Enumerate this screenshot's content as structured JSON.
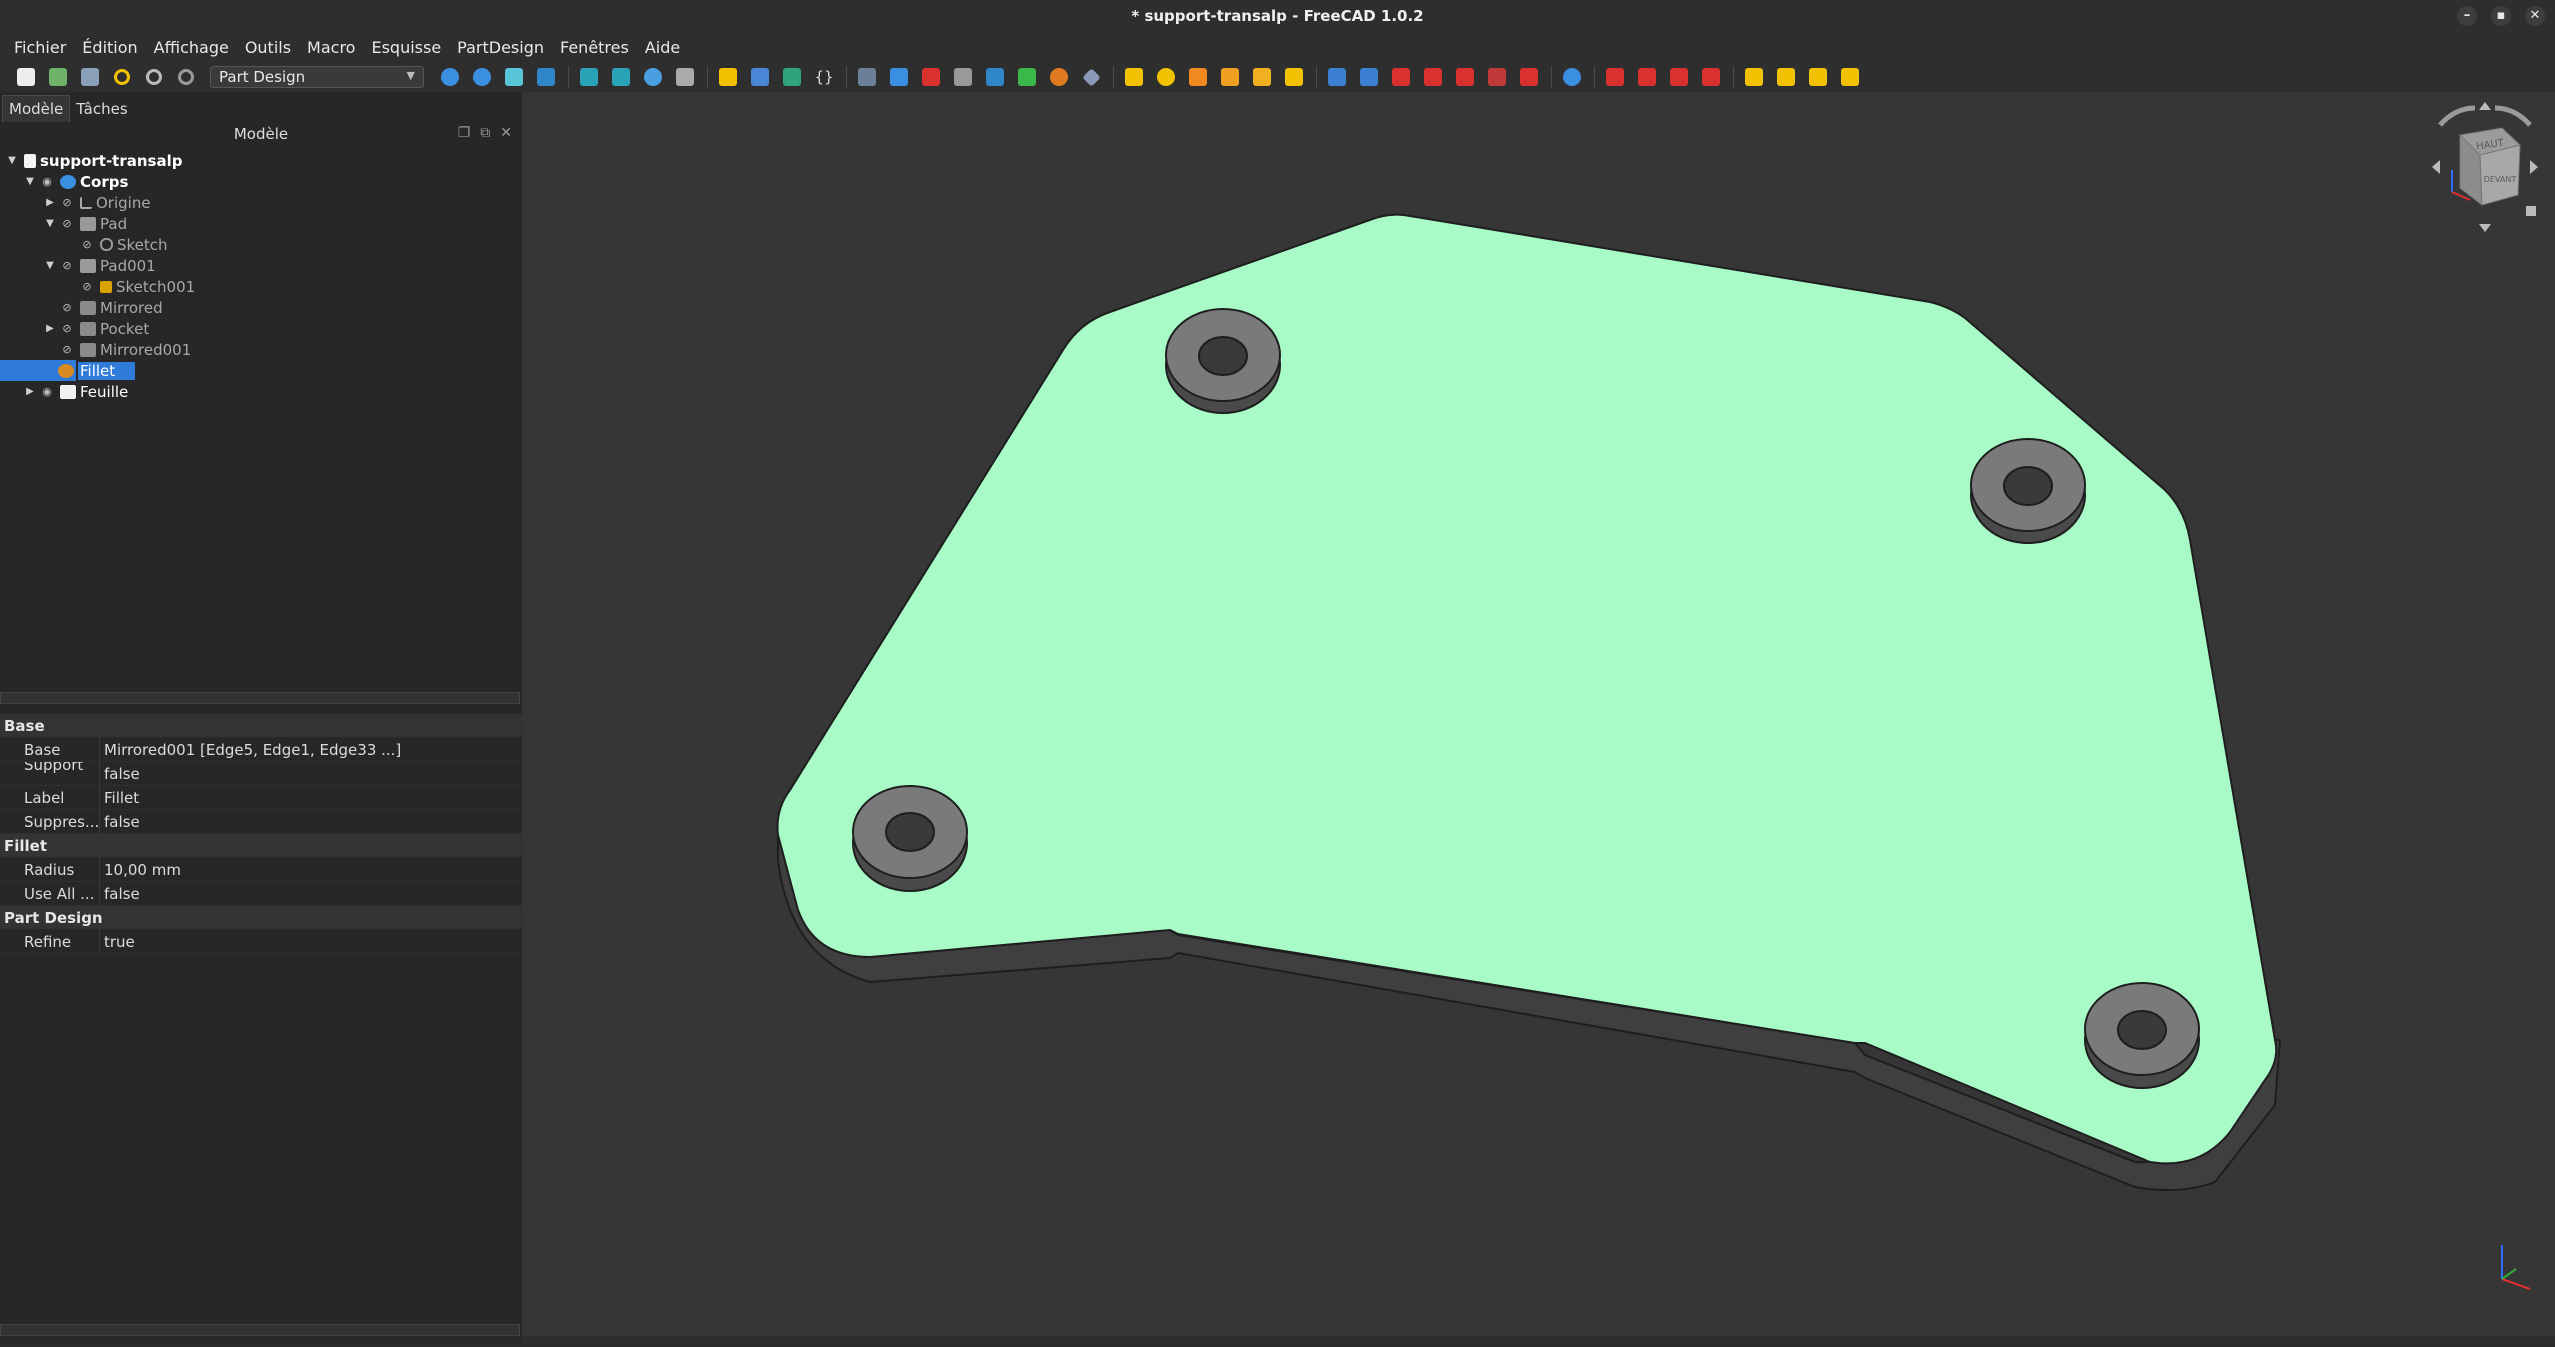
{
  "window": {
    "title": "* support-transalp - FreeCAD 1.0.2",
    "controls": [
      "–",
      "▪",
      "✕"
    ]
  },
  "menu": [
    "Fichier",
    "Édition",
    "Affichage",
    "Outils",
    "Macro",
    "Esquisse",
    "PartDesign",
    "Fenêtres",
    "Aide"
  ],
  "toolbar": {
    "workbench": "Part Design",
    "group1": [
      "new-icon",
      "open-icon",
      "save-icon",
      "undo-icon",
      "redo-icon",
      "refresh-icon"
    ],
    "colors": {
      "accent": "#f2c200",
      "blue": "#3a8fe0",
      "red": "#d93030",
      "green": "#3bb84a"
    }
  },
  "panel": {
    "tabs": [
      "Modèle",
      "Tâches"
    ],
    "tree_header": "Modèle",
    "tree": [
      {
        "label": "support-transalp",
        "bold": true
      },
      {
        "label": "Corps",
        "bold": true
      },
      {
        "label": "Origine"
      },
      {
        "label": "Pad"
      },
      {
        "label": "Sketch"
      },
      {
        "label": "Pad001"
      },
      {
        "label": "Sketch001"
      },
      {
        "label": "Mirrored"
      },
      {
        "label": "Pocket"
      },
      {
        "label": "Mirrored001"
      },
      {
        "label": "Fillet",
        "selected": true
      },
      {
        "label": "Feuille"
      }
    ]
  },
  "properties": {
    "base_section": "Base",
    "base_rows": [
      {
        "key": "Base",
        "value": "Mirrored001 [Edge5, Edge1, Edge33 ...]"
      },
      {
        "key": "Support ...",
        "value": "false"
      },
      {
        "key": "Label",
        "value": "Fillet"
      },
      {
        "key": "Suppres...",
        "value": "false"
      }
    ],
    "fillet_section": "Fillet",
    "fillet_rows": [
      {
        "key": "Radius",
        "value": "10,00 mm"
      },
      {
        "key": "Use All ...",
        "value": "false"
      }
    ],
    "pd_section": "Part Design",
    "pd_rows": [
      {
        "key": "Refine",
        "value": "true"
      }
    ]
  },
  "navcube": {
    "top_face": "HAUT",
    "front_face": "DEVANT"
  },
  "model": {
    "face_color": "#a8fbc6",
    "side_color": "#3f3f3f"
  }
}
